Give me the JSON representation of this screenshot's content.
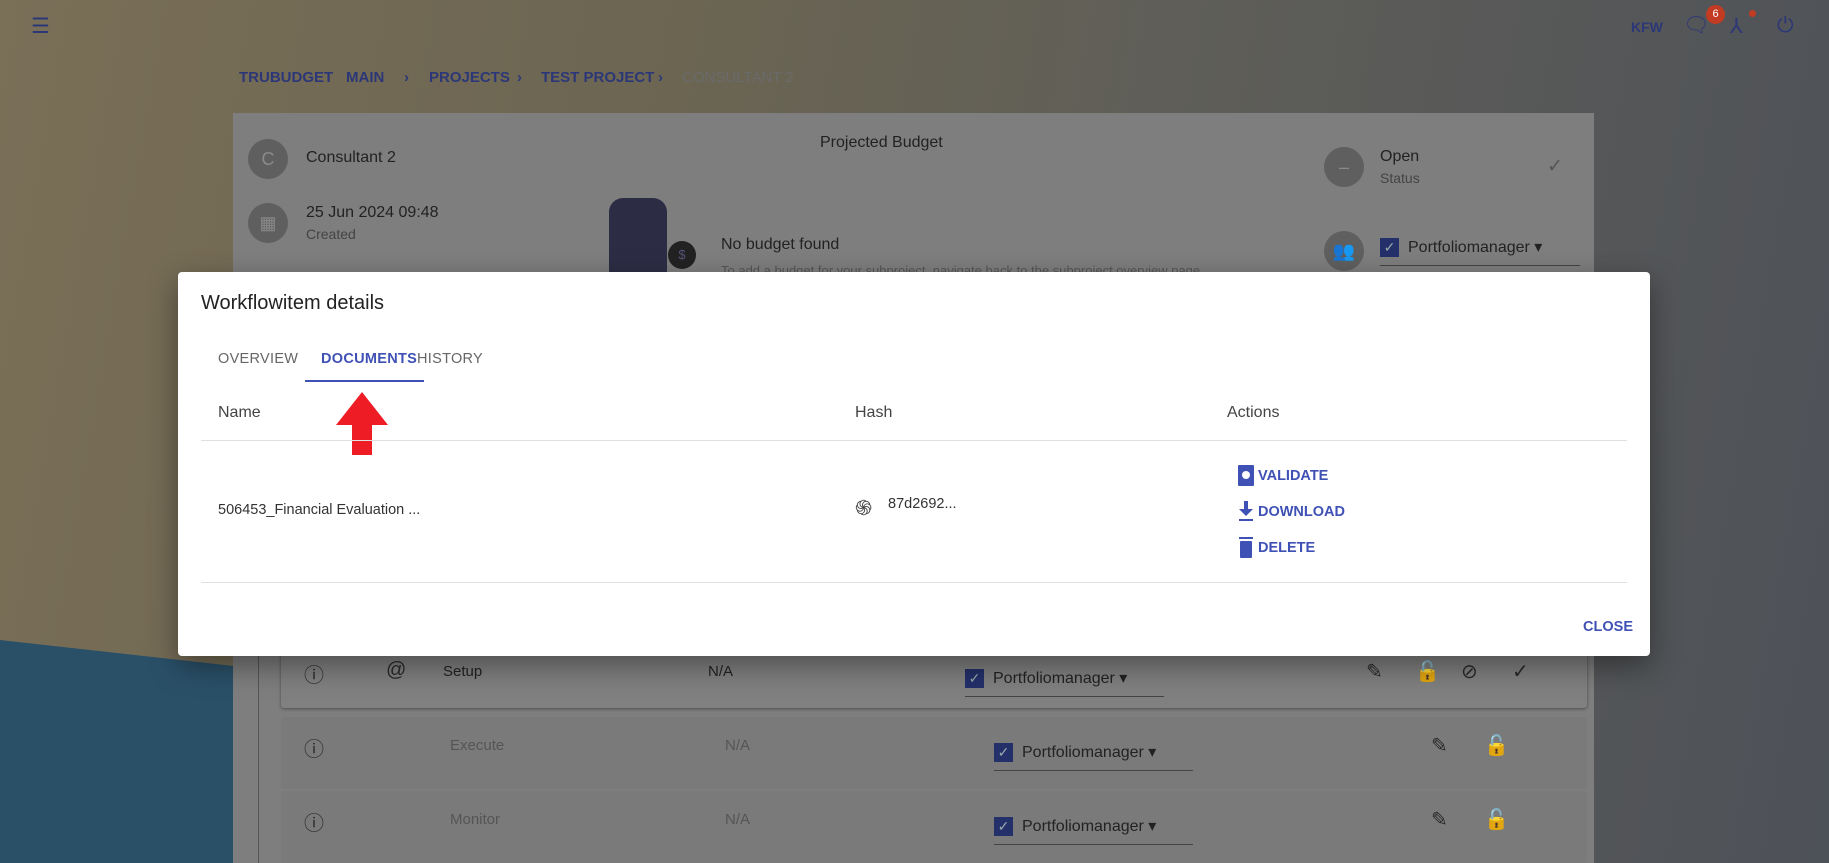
{
  "header": {
    "user": "KFW",
    "notification_count": "6"
  },
  "breadcrumb": [
    "TRUBUDGET",
    "MAIN",
    "PROJECTS",
    "TEST PROJECT",
    "CONSULTANT 2"
  ],
  "subproject": {
    "avatar_letter": "C",
    "name": "Consultant 2",
    "created_date": "25 Jun 2024 09:48",
    "created_label": "Created",
    "budget_title": "Projected Budget",
    "no_budget": "No budget found",
    "no_budget_hint": "To add a budget for your subproject, navigate back to the subproject overview page.",
    "status": "Open",
    "status_label": "Status",
    "assignee": "Portfoliomanager"
  },
  "workflowitems": [
    {
      "name": "Setup",
      "amount": "N/A",
      "assignee": "Portfoliomanager"
    },
    {
      "name": "Execute",
      "amount": "N/A",
      "assignee": "Portfoliomanager"
    },
    {
      "name": "Monitor",
      "amount": "N/A",
      "assignee": "Portfoliomanager"
    }
  ],
  "dialog": {
    "title": "Workflowitem details",
    "tabs": [
      "OVERVIEW",
      "DOCUMENTS",
      "HISTORY"
    ],
    "active_tab": "DOCUMENTS",
    "columns": [
      "Name",
      "Hash",
      "Actions"
    ],
    "documents": [
      {
        "name": "506453_Financial Evaluation ...",
        "hash": "87d2692...",
        "actions": [
          "VALIDATE",
          "DOWNLOAD",
          "DELETE"
        ]
      }
    ],
    "close": "CLOSE"
  },
  "colors": {
    "accent": "#3f51b5",
    "arrow": "#ee1c25",
    "badge": "#c23b22"
  }
}
